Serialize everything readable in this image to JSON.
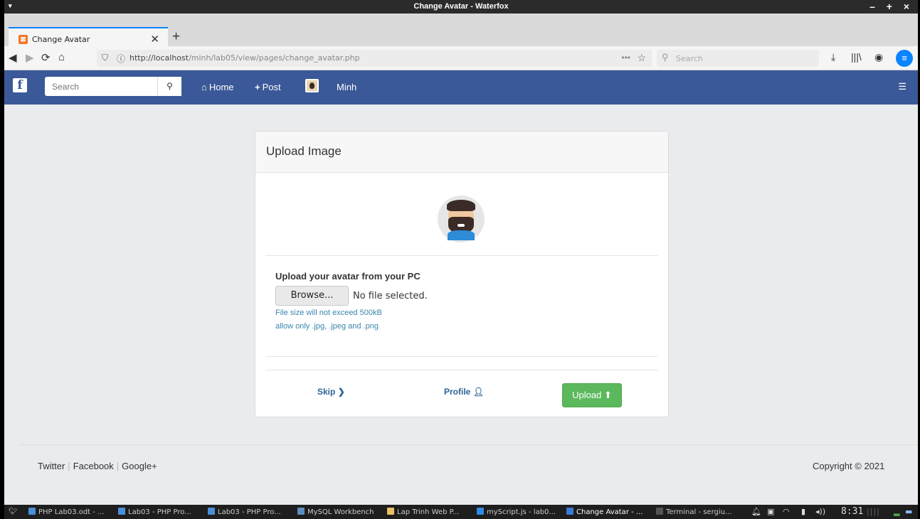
{
  "window": {
    "title": "Change Avatar - Waterfox",
    "menu_icon": "▾",
    "controls": "– + ×"
  },
  "tabs": [
    {
      "label": "Change Avatar",
      "active": true
    }
  ],
  "toolbar": {
    "url_host": "http://localhost",
    "url_path": "/minh/lab05/view/pages/change_avatar.php",
    "search_placeholder": "Search",
    "more": "•••"
  },
  "site_nav": {
    "logo": "f",
    "search_placeholder": "Search",
    "home": "Home",
    "post": "Post",
    "user": "Minh"
  },
  "panel": {
    "title": "Upload Image",
    "upload_heading": "Upload your avatar from your PC",
    "browse_label": "Browse...",
    "file_status": "No file selected.",
    "hint_size": "File size will not exceed 500kB",
    "hint_types": "allow only .jpg, .jpeg and .png",
    "skip": "Skip",
    "profile": "Profile",
    "upload": "Upload"
  },
  "footer": {
    "links": [
      "Twitter",
      "Facebook",
      "Google+"
    ],
    "copyright": "Copyright © 2021"
  },
  "taskbar": {
    "items": [
      {
        "label": "PHP Lab03.odt - ...",
        "color": "#4a8fd8"
      },
      {
        "label": "Lab03 - PHP Pro...",
        "color": "#4a8fd8"
      },
      {
        "label": "Lab03 - PHP Pro...",
        "color": "#4a8fd8"
      },
      {
        "label": "MySQL Workbench",
        "color": "#5c8fbf"
      },
      {
        "label": "Lap Trinh Web P...",
        "color": "#e8c163"
      },
      {
        "label": "myScript.js - lab0...",
        "color": "#2f8be0"
      },
      {
        "label": "Change Avatar - ...",
        "color": "#3a7bd5"
      },
      {
        "label": "Terminal - sergiu...",
        "color": "#555555"
      }
    ],
    "clock": "8:31"
  },
  "colors": {
    "fb_blue": "#3b5998",
    "upload_green": "#5cb85c",
    "hint_blue": "#3a87ad",
    "link_blue": "#2a6496"
  }
}
